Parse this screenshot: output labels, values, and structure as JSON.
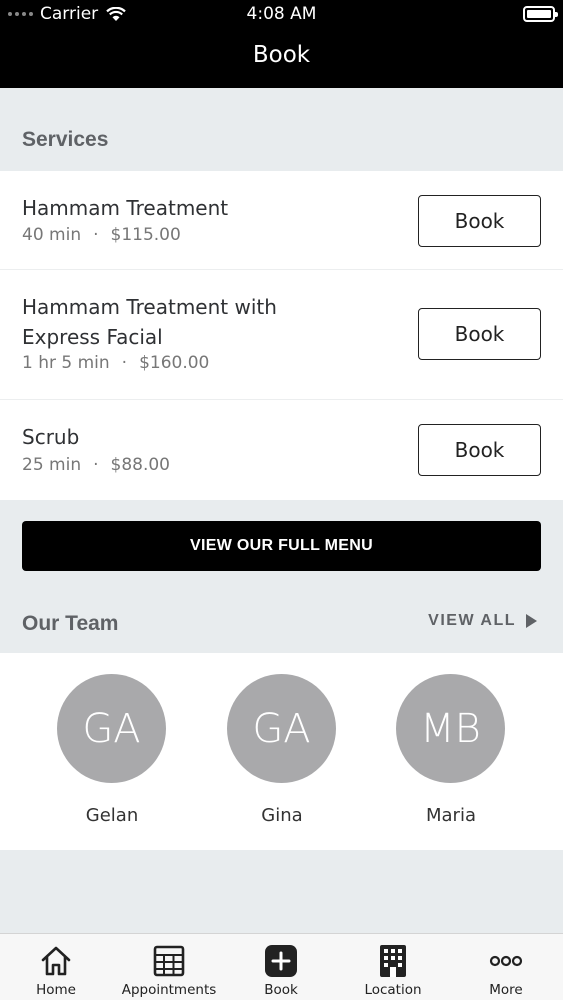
{
  "status_bar": {
    "carrier": "Carrier",
    "time": "4:08 AM"
  },
  "nav": {
    "title": "Book"
  },
  "services": {
    "heading": "Services",
    "items": [
      {
        "name": "Hammam Treatment",
        "duration": "40 min",
        "price": "$115.00",
        "button": "Book"
      },
      {
        "name": "Hammam Treatment with Express Facial",
        "duration": "1 hr 5 min",
        "price": "$160.00",
        "button": "Book"
      },
      {
        "name": "Scrub",
        "duration": "25 min",
        "price": "$88.00",
        "button": "Book"
      }
    ],
    "separator": "·",
    "menu_button": "VIEW OUR FULL MENU"
  },
  "team": {
    "heading": "Our Team",
    "view_all": "VIEW ALL",
    "members": [
      {
        "initials": "GA",
        "name": "Gelan"
      },
      {
        "initials": "GA",
        "name": "Gina"
      },
      {
        "initials": "MB",
        "name": "Maria"
      }
    ]
  },
  "tabbar": {
    "items": [
      {
        "label": "Home",
        "icon": "home-icon"
      },
      {
        "label": "Appointments",
        "icon": "calendar-icon"
      },
      {
        "label": "Book",
        "icon": "plus-icon"
      },
      {
        "label": "Location",
        "icon": "building-icon"
      },
      {
        "label": "More",
        "icon": "more-icon"
      }
    ]
  },
  "colors": {
    "background": "#e8ecee",
    "header": "#000000",
    "avatar": "#a9a9ab",
    "section_heading": "#5f6266"
  }
}
